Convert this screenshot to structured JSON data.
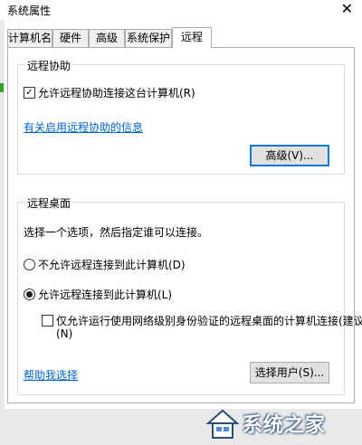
{
  "window": {
    "title": "系统属性",
    "close_glyph": "✕"
  },
  "tabs": [
    {
      "label": "计算机名"
    },
    {
      "label": "硬件"
    },
    {
      "label": "高级"
    },
    {
      "label": "系统保护"
    },
    {
      "label": "远程",
      "active": true
    }
  ],
  "remote_assistance": {
    "group_title": "远程协助",
    "allow_checkbox_label": "允许远程协助连接这台计算机(R)",
    "allow_checked": true,
    "info_link": "有关启用远程协助的信息",
    "advanced_button": "高级(V)..."
  },
  "remote_desktop": {
    "group_title": "远程桌面",
    "instruction": "选择一个选项，然后指定谁可以连接。",
    "option_deny": "不允许远程连接到此计算机(D)",
    "option_allow": "允许远程连接到此计算机(L)",
    "selected_option": "allow",
    "nla_checkbox_label_line1": "仅允许运行使用网络级别身份验证的远程桌面的计算机连接(建议)",
    "nla_checkbox_label_line2": "(N)",
    "nla_checked": false,
    "help_link": "帮助我选择",
    "select_users_button": "选择用户(S)..."
  },
  "watermark": {
    "text": "系统之家",
    "icon": "house-logo-icon"
  },
  "colors": {
    "link": "#0066cc",
    "focus_border": "#0078d7",
    "button_bg": "#e1e1e1"
  }
}
